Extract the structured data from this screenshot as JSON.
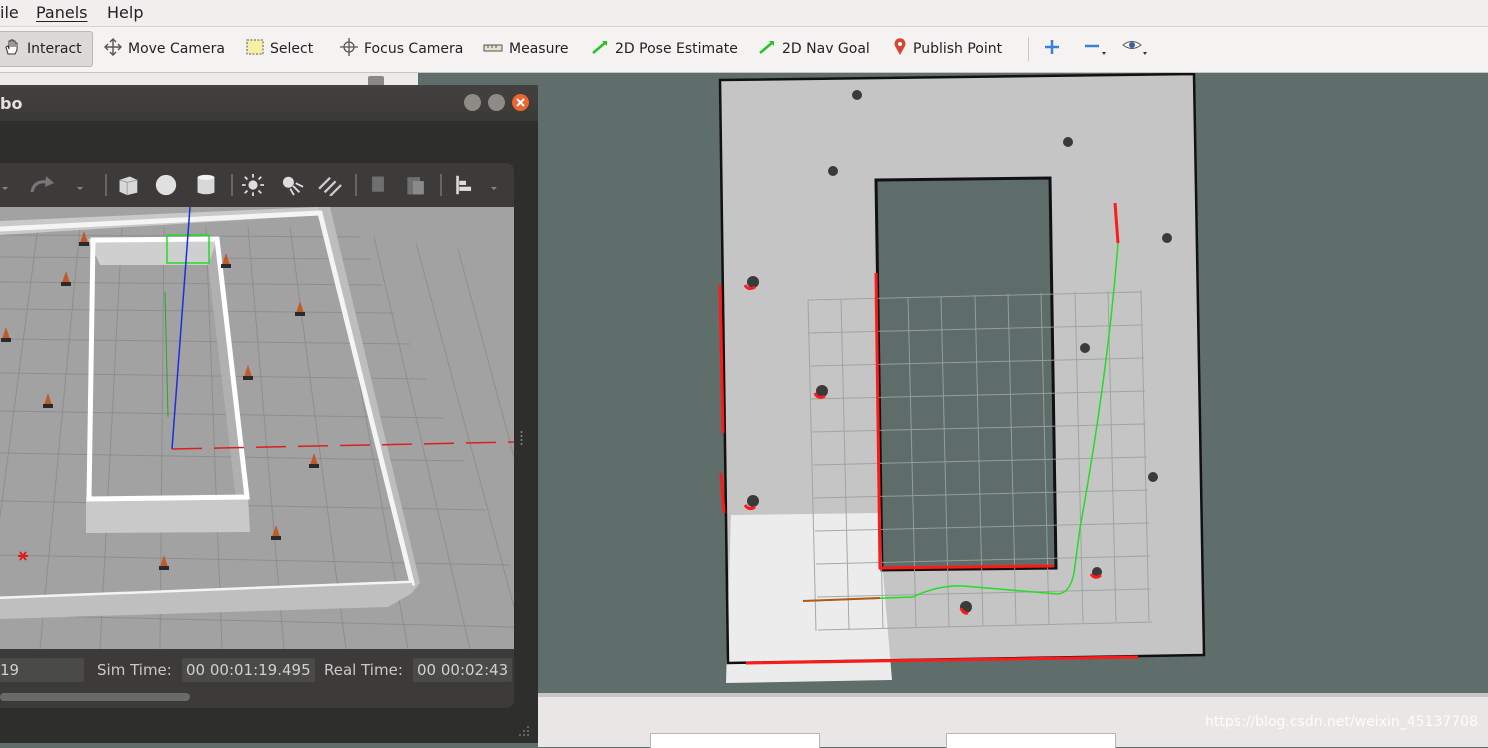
{
  "menubar": {
    "items": [
      "ile",
      "Panels",
      "Help"
    ]
  },
  "toolbar": {
    "interact": "Interact",
    "move_camera": "Move Camera",
    "select": "Select",
    "focus_camera": "Focus Camera",
    "measure": "Measure",
    "pose_estimate": "2D Pose Estimate",
    "nav_goal": "2D Nav Goal",
    "publish_point": "Publish Point"
  },
  "gazebo": {
    "title": "bo",
    "status": {
      "iterations_value": "19",
      "sim_time_label": "Sim Time:",
      "sim_time_value": "00 00:01:19.495",
      "real_time_label": "Real Time:",
      "real_time_value": "00 00:02:43"
    }
  },
  "watermark": "https://blog.csdn.net/weixin_45137708",
  "colors": {
    "rviz_bg": "#5f6e6b",
    "map_free": "#c6c6c6",
    "laser": "#ff0000",
    "path": "#22dd22",
    "close_button": "#e9672e"
  },
  "icons": [
    "hand-icon",
    "move-camera-icon",
    "select-icon",
    "focus-camera-icon",
    "measure-icon",
    "pose-estimate-arrow-icon",
    "nav-goal-arrow-icon",
    "map-pin-icon",
    "plus-icon",
    "minus-icon",
    "eye-icon"
  ]
}
